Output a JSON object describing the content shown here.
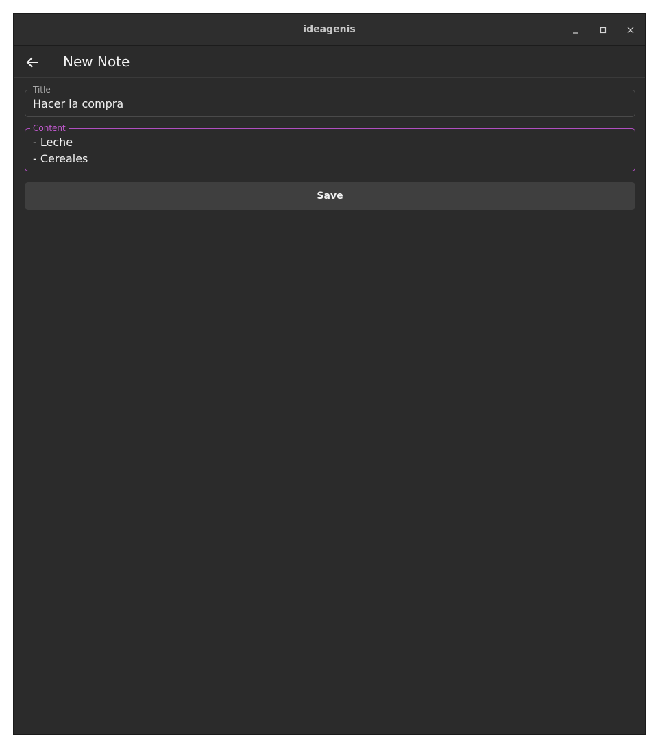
{
  "window": {
    "title": "ideagenis",
    "controls": [
      "minimize-icon",
      "maximize-icon",
      "close-icon"
    ]
  },
  "appbar": {
    "back_icon": "arrow-left-icon",
    "title": "New Note"
  },
  "form": {
    "title_field": {
      "label": "Title",
      "value": "Hacer la compra"
    },
    "content_field": {
      "label": "Content",
      "lines": [
        "- Leche",
        "- Cereales"
      ]
    },
    "save_label": "Save"
  },
  "colors": {
    "background": "#2b2b2b",
    "accent": "#c35ad0",
    "button": "#3f3f3f"
  }
}
